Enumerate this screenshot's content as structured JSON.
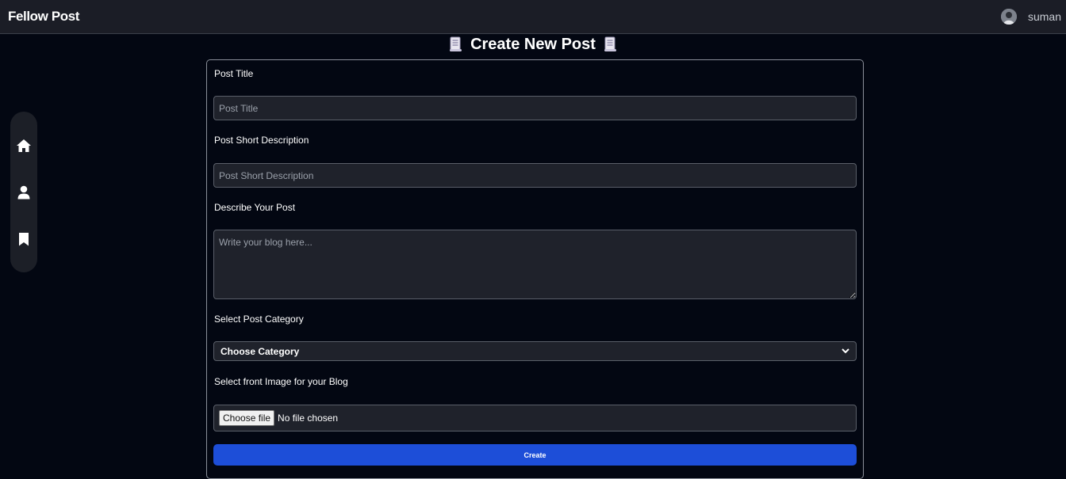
{
  "navbar": {
    "brand": "Fellow Post",
    "username": "suman",
    "avatar_icon": "user-avatar"
  },
  "sidebar": {
    "items": [
      {
        "icon": "home-icon"
      },
      {
        "icon": "user-icon"
      },
      {
        "icon": "bookmark-icon"
      }
    ]
  },
  "page": {
    "title": "Create New Post",
    "title_icon": "scroll-icon"
  },
  "form": {
    "post_title": {
      "label": "Post Title",
      "placeholder": "Post Title",
      "value": ""
    },
    "short_description": {
      "label": "Post Short Description",
      "placeholder": "Post Short Description",
      "value": ""
    },
    "body": {
      "label": "Describe Your Post",
      "placeholder": "Write your blog here...",
      "value": ""
    },
    "category": {
      "label": "Select Post Category",
      "selected": "Choose Category"
    },
    "image": {
      "label": "Select front Image for your Blog",
      "button_label": "Choose file",
      "status": "No file chosen"
    },
    "submit_label": "Create"
  },
  "colors": {
    "background": "#030712",
    "navbar": "#1b1d26",
    "input_bg": "#1f222b",
    "accent": "#1d4ed8"
  }
}
